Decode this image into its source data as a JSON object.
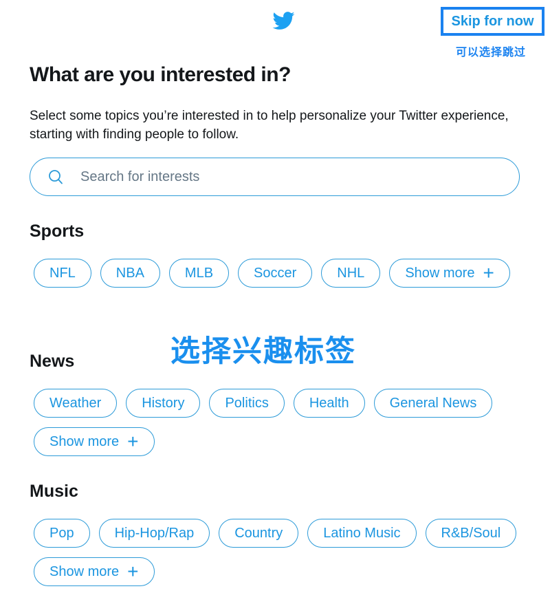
{
  "header": {
    "logo_icon": "twitter-bird-icon",
    "skip_label": "Skip for now",
    "skip_annotation": "可以选择跳过"
  },
  "page": {
    "title": "What are you interested in?",
    "description": "Select some topics you’re interested in to help personalize your Twitter experience, starting with finding people to follow."
  },
  "search": {
    "icon": "search-icon",
    "placeholder": "Search for interests",
    "value": ""
  },
  "sections": [
    {
      "title": "Sports",
      "topics": [
        "NFL",
        "NBA",
        "MLB",
        "Soccer",
        "NHL"
      ],
      "show_more": "Show more"
    },
    {
      "title": "News",
      "topics": [
        "Weather",
        "History",
        "Politics",
        "Health",
        "General News"
      ],
      "show_more": "Show more"
    },
    {
      "title": "Music",
      "topics": [
        "Pop",
        "Hip-Hop/Rap",
        "Country",
        "Latino Music",
        "R&B/Soul"
      ],
      "show_more": "Show more"
    }
  ],
  "annotation": {
    "overlay_text": "选择兴趣标签"
  },
  "colors": {
    "accent": "#1b95e0",
    "annotation_blue": "#1a82f0",
    "text": "#14171a",
    "placeholder": "#657786"
  }
}
